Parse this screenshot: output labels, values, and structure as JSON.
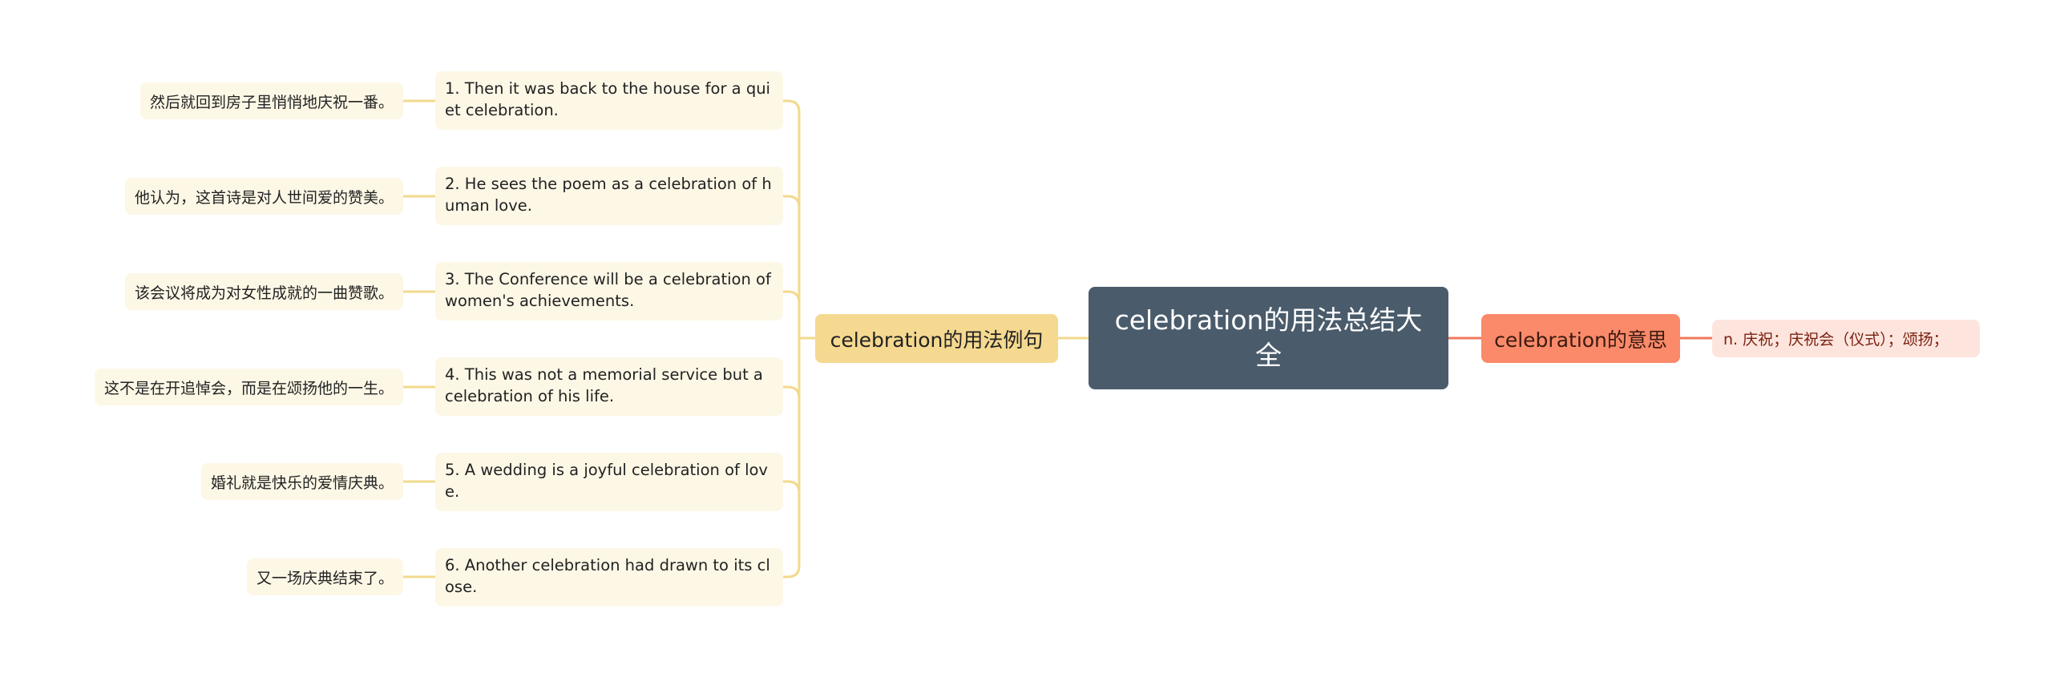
{
  "root": {
    "title": "celebration的用法总结大全"
  },
  "branches": {
    "examples": {
      "label": "celebration的用法例句"
    },
    "meaning": {
      "label": "celebration的意思",
      "definition": "n. 庆祝；庆祝会（仪式）；颂扬；"
    }
  },
  "examples": [
    {
      "en": "1. Then it was back to the house for a quiet celebration.",
      "zh": "然后就回到房子里悄悄地庆祝一番。"
    },
    {
      "en": "2. He sees the poem as a celebration of human love.",
      "zh": "他认为，这首诗是对人世间爱的赞美。"
    },
    {
      "en": "3. The Conference will be a celebration of women's achievements.",
      "zh": "该会议将成为对女性成就的一曲赞歌。"
    },
    {
      "en": "4. This was not a memorial service but a celebration of his life.",
      "zh": "这不是在开追悼会，而是在颂扬他的一生。"
    },
    {
      "en": "5. A wedding is a joyful celebration of love.",
      "zh": "婚礼就是快乐的爱情庆典。"
    },
    {
      "en": "6. Another celebration had drawn to its close.",
      "zh": "又一场庆典结束了。"
    }
  ],
  "colors": {
    "root": "#4a5b6b",
    "examples_branch": "#f5d990",
    "meaning_branch": "#fa8a6a",
    "leaf_examples": "#fdf7e6",
    "leaf_meaning": "#fde5de",
    "line_examples": "#f2d98c",
    "line_meaning": "#f0785c"
  }
}
